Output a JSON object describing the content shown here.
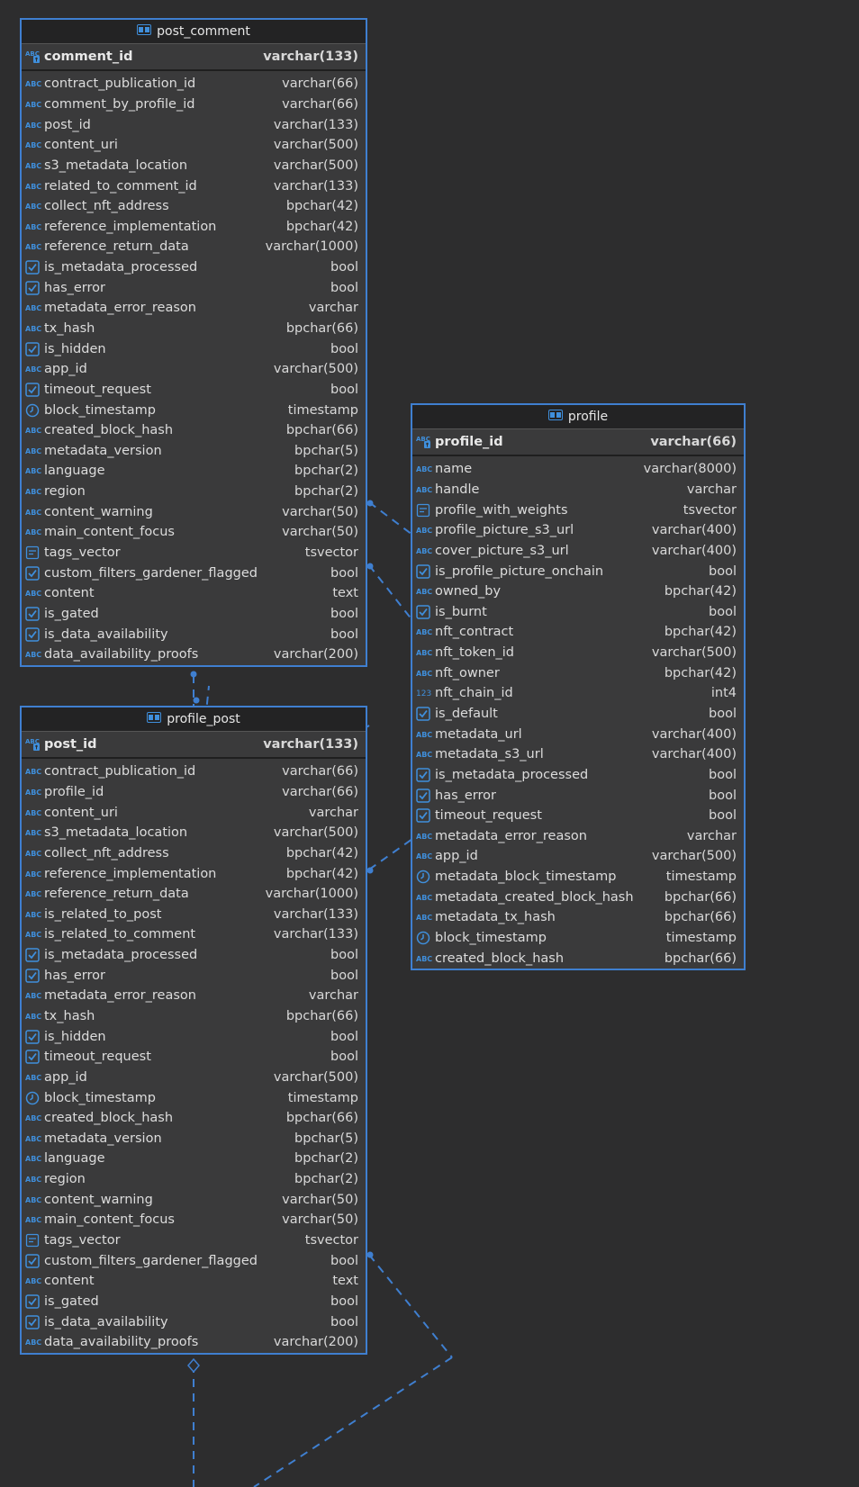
{
  "theme": {
    "background": "#2d2d2e",
    "entity_background": "#3a3a3b",
    "entity_border": "#3f7fd0",
    "header_background": "#232324",
    "icon_accent": "#3f8fdc"
  },
  "entities": {
    "post_comment": {
      "name": "post_comment",
      "pk": {
        "name": "comment_id",
        "type": "varchar(133)",
        "icon": "key-text-icon"
      },
      "columns": [
        {
          "name": "contract_publication_id",
          "type": "varchar(66)",
          "icon": "abc"
        },
        {
          "name": "comment_by_profile_id",
          "type": "varchar(66)",
          "icon": "abc"
        },
        {
          "name": "post_id",
          "type": "varchar(133)",
          "icon": "abc"
        },
        {
          "name": "content_uri",
          "type": "varchar(500)",
          "icon": "abc"
        },
        {
          "name": "s3_metadata_location",
          "type": "varchar(500)",
          "icon": "abc"
        },
        {
          "name": "related_to_comment_id",
          "type": "varchar(133)",
          "icon": "abc"
        },
        {
          "name": "collect_nft_address",
          "type": "bpchar(42)",
          "icon": "abc"
        },
        {
          "name": "reference_implementation",
          "type": "bpchar(42)",
          "icon": "abc"
        },
        {
          "name": "reference_return_data",
          "type": "varchar(1000)",
          "icon": "abc"
        },
        {
          "name": "is_metadata_processed",
          "type": "bool",
          "icon": "check"
        },
        {
          "name": "has_error",
          "type": "bool",
          "icon": "check"
        },
        {
          "name": "metadata_error_reason",
          "type": "varchar",
          "icon": "abc"
        },
        {
          "name": "tx_hash",
          "type": "bpchar(66)",
          "icon": "abc"
        },
        {
          "name": "is_hidden",
          "type": "bool",
          "icon": "check"
        },
        {
          "name": "app_id",
          "type": "varchar(500)",
          "icon": "abc"
        },
        {
          "name": "timeout_request",
          "type": "bool",
          "icon": "check"
        },
        {
          "name": "block_timestamp",
          "type": "timestamp",
          "icon": "clock"
        },
        {
          "name": "created_block_hash",
          "type": "bpchar(66)",
          "icon": "abc"
        },
        {
          "name": "metadata_version",
          "type": "bpchar(5)",
          "icon": "abc"
        },
        {
          "name": "language",
          "type": "bpchar(2)",
          "icon": "abc"
        },
        {
          "name": "region",
          "type": "bpchar(2)",
          "icon": "abc"
        },
        {
          "name": "content_warning",
          "type": "varchar(50)",
          "icon": "abc"
        },
        {
          "name": "main_content_focus",
          "type": "varchar(50)",
          "icon": "abc"
        },
        {
          "name": "tags_vector",
          "type": "tsvector",
          "icon": "doc"
        },
        {
          "name": "custom_filters_gardener_flagged",
          "type": "bool",
          "icon": "check"
        },
        {
          "name": "content",
          "type": "text",
          "icon": "abc"
        },
        {
          "name": "is_gated",
          "type": "bool",
          "icon": "check"
        },
        {
          "name": "is_data_availability",
          "type": "bool",
          "icon": "check"
        },
        {
          "name": "data_availability_proofs",
          "type": "varchar(200)",
          "icon": "abc"
        }
      ]
    },
    "profile_post": {
      "name": "profile_post",
      "pk": {
        "name": "post_id",
        "type": "varchar(133)",
        "icon": "key-text-icon"
      },
      "columns": [
        {
          "name": "contract_publication_id",
          "type": "varchar(66)",
          "icon": "abc"
        },
        {
          "name": "profile_id",
          "type": "varchar(66)",
          "icon": "abc"
        },
        {
          "name": "content_uri",
          "type": "varchar",
          "icon": "abc"
        },
        {
          "name": "s3_metadata_location",
          "type": "varchar(500)",
          "icon": "abc"
        },
        {
          "name": "collect_nft_address",
          "type": "bpchar(42)",
          "icon": "abc"
        },
        {
          "name": "reference_implementation",
          "type": "bpchar(42)",
          "icon": "abc"
        },
        {
          "name": "reference_return_data",
          "type": "varchar(1000)",
          "icon": "abc"
        },
        {
          "name": "is_related_to_post",
          "type": "varchar(133)",
          "icon": "abc"
        },
        {
          "name": "is_related_to_comment",
          "type": "varchar(133)",
          "icon": "abc"
        },
        {
          "name": "is_metadata_processed",
          "type": "bool",
          "icon": "check"
        },
        {
          "name": "has_error",
          "type": "bool",
          "icon": "check"
        },
        {
          "name": "metadata_error_reason",
          "type": "varchar",
          "icon": "abc"
        },
        {
          "name": "tx_hash",
          "type": "bpchar(66)",
          "icon": "abc"
        },
        {
          "name": "is_hidden",
          "type": "bool",
          "icon": "check"
        },
        {
          "name": "timeout_request",
          "type": "bool",
          "icon": "check"
        },
        {
          "name": "app_id",
          "type": "varchar(500)",
          "icon": "abc"
        },
        {
          "name": "block_timestamp",
          "type": "timestamp",
          "icon": "clock"
        },
        {
          "name": "created_block_hash",
          "type": "bpchar(66)",
          "icon": "abc"
        },
        {
          "name": "metadata_version",
          "type": "bpchar(5)",
          "icon": "abc"
        },
        {
          "name": "language",
          "type": "bpchar(2)",
          "icon": "abc"
        },
        {
          "name": "region",
          "type": "bpchar(2)",
          "icon": "abc"
        },
        {
          "name": "content_warning",
          "type": "varchar(50)",
          "icon": "abc"
        },
        {
          "name": "main_content_focus",
          "type": "varchar(50)",
          "icon": "abc"
        },
        {
          "name": "tags_vector",
          "type": "tsvector",
          "icon": "doc"
        },
        {
          "name": "custom_filters_gardener_flagged",
          "type": "bool",
          "icon": "check"
        },
        {
          "name": "content",
          "type": "text",
          "icon": "abc"
        },
        {
          "name": "is_gated",
          "type": "bool",
          "icon": "check"
        },
        {
          "name": "is_data_availability",
          "type": "bool",
          "icon": "check"
        },
        {
          "name": "data_availability_proofs",
          "type": "varchar(200)",
          "icon": "abc"
        }
      ]
    },
    "profile": {
      "name": "profile",
      "pk": {
        "name": "profile_id",
        "type": "varchar(66)",
        "icon": "key-text-icon"
      },
      "columns": [
        {
          "name": "name",
          "type": "varchar(8000)",
          "icon": "abc"
        },
        {
          "name": "handle",
          "type": "varchar",
          "icon": "abc"
        },
        {
          "name": "profile_with_weights",
          "type": "tsvector",
          "icon": "doc"
        },
        {
          "name": "profile_picture_s3_url",
          "type": "varchar(400)",
          "icon": "abc"
        },
        {
          "name": "cover_picture_s3_url",
          "type": "varchar(400)",
          "icon": "abc"
        },
        {
          "name": "is_profile_picture_onchain",
          "type": "bool",
          "icon": "check"
        },
        {
          "name": "owned_by",
          "type": "bpchar(42)",
          "icon": "abc"
        },
        {
          "name": "is_burnt",
          "type": "bool",
          "icon": "check"
        },
        {
          "name": "nft_contract",
          "type": "bpchar(42)",
          "icon": "abc"
        },
        {
          "name": "nft_token_id",
          "type": "varchar(500)",
          "icon": "abc"
        },
        {
          "name": "nft_owner",
          "type": "bpchar(42)",
          "icon": "abc"
        },
        {
          "name": "nft_chain_id",
          "type": "int4",
          "icon": "num"
        },
        {
          "name": "is_default",
          "type": "bool",
          "icon": "check"
        },
        {
          "name": "metadata_url",
          "type": "varchar(400)",
          "icon": "abc"
        },
        {
          "name": "metadata_s3_url",
          "type": "varchar(400)",
          "icon": "abc"
        },
        {
          "name": "is_metadata_processed",
          "type": "bool",
          "icon": "check"
        },
        {
          "name": "has_error",
          "type": "bool",
          "icon": "check"
        },
        {
          "name": "timeout_request",
          "type": "bool",
          "icon": "check"
        },
        {
          "name": "metadata_error_reason",
          "type": "varchar",
          "icon": "abc"
        },
        {
          "name": "app_id",
          "type": "varchar(500)",
          "icon": "abc"
        },
        {
          "name": "metadata_block_timestamp",
          "type": "timestamp",
          "icon": "clock"
        },
        {
          "name": "metadata_created_block_hash",
          "type": "bpchar(66)",
          "icon": "abc"
        },
        {
          "name": "metadata_tx_hash",
          "type": "bpchar(66)",
          "icon": "abc"
        },
        {
          "name": "block_timestamp",
          "type": "timestamp",
          "icon": "clock"
        },
        {
          "name": "created_block_hash",
          "type": "bpchar(66)",
          "icon": "abc"
        }
      ]
    }
  }
}
